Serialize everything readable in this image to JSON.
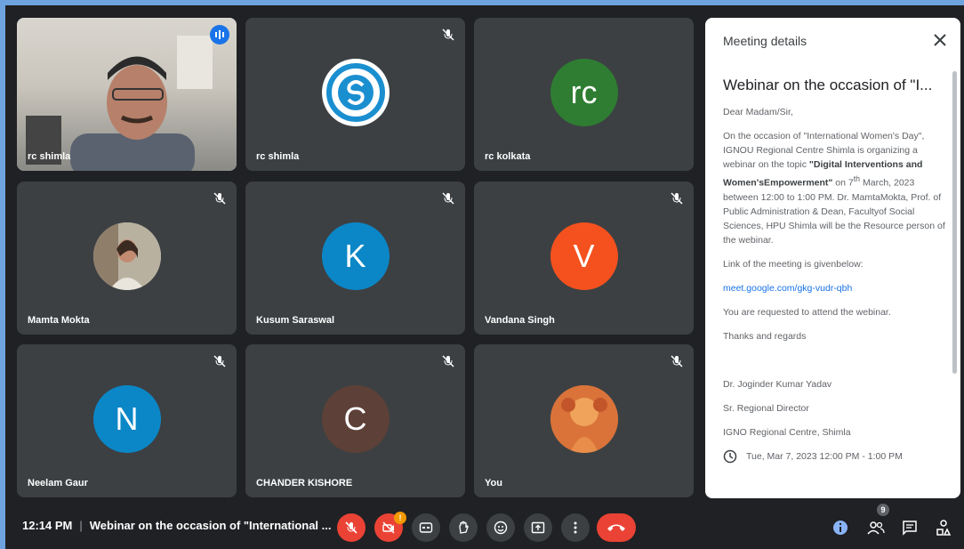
{
  "tiles": [
    {
      "name": "rc shimla",
      "type": "video",
      "speaking": true
    },
    {
      "name": "rc shimla",
      "type": "logo",
      "muted": true
    },
    {
      "name": "rc kolkata",
      "type": "initials",
      "initials": "rc",
      "color": "#2e7d32"
    },
    {
      "name": "Mamta Mokta",
      "type": "photo",
      "muted": true
    },
    {
      "name": "Kusum Saraswal",
      "type": "initials",
      "initials": "K",
      "color": "#0b87c7",
      "muted": true
    },
    {
      "name": "Vandana Singh",
      "type": "initials",
      "initials": "V",
      "color": "#f4511e",
      "muted": true
    },
    {
      "name": "Neelam Gaur",
      "type": "initials",
      "initials": "N",
      "color": "#0b87c7",
      "muted": true
    },
    {
      "name": "CHANDER KISHORE",
      "type": "initials",
      "initials": "C",
      "color": "#5d4037",
      "muted": true
    },
    {
      "name": "You",
      "type": "photo",
      "muted": true
    }
  ],
  "panel": {
    "heading": "Meeting details",
    "title": "Webinar on the occasion of \"I...",
    "greeting": "Dear Madam/Sir,",
    "para1_a": "On the occasion of \"International Women's Day\", IGNOU Regional Centre Shimla is organizing a webinar on the topic ",
    "para1_bold": "\"Digital Interventions and Women'sEmpowerment\"",
    "para1_b": " on ",
    "para1_day": "7",
    "para1_sup": "th",
    "para1_c": " March, 2023 between 12:00 to 1:00 PM. Dr. MamtaMokta, Prof. of Public Administration & Dean, Facultyof Social Sciences, HPU Shimla will be the Resource person of the webinar.",
    "link_intro": " Link of the meeting is givenbelow:",
    "link": "meet.google.com/gkg-vudr-qbh",
    "request": "You are requested to attend the webinar.",
    "regards": "Thanks and regards",
    "sign_name": "Dr. Joginder Kumar Yadav",
    "sign_role": "Sr. Regional Director",
    "sign_org": "IGNO Regional Centre, Shimla",
    "event_time": "Tue, Mar 7, 2023 12:00 PM - 1:00 PM"
  },
  "bottom": {
    "time": "12:14 PM",
    "separator": "|",
    "meeting_title": "Webinar on the occasion of \"International ...",
    "camera_badge": "!",
    "people_count": "9"
  },
  "icons": {
    "mic_off": "mic-off-icon",
    "camera_off": "camera-off-icon",
    "captions": "captions-icon",
    "raise_hand": "hand-icon",
    "emoji": "emoji-icon",
    "present": "present-icon",
    "more": "more-vert-icon",
    "leave": "call-end-icon",
    "info": "info-icon",
    "people": "people-icon",
    "chat": "chat-icon",
    "activities": "activities-icon"
  }
}
